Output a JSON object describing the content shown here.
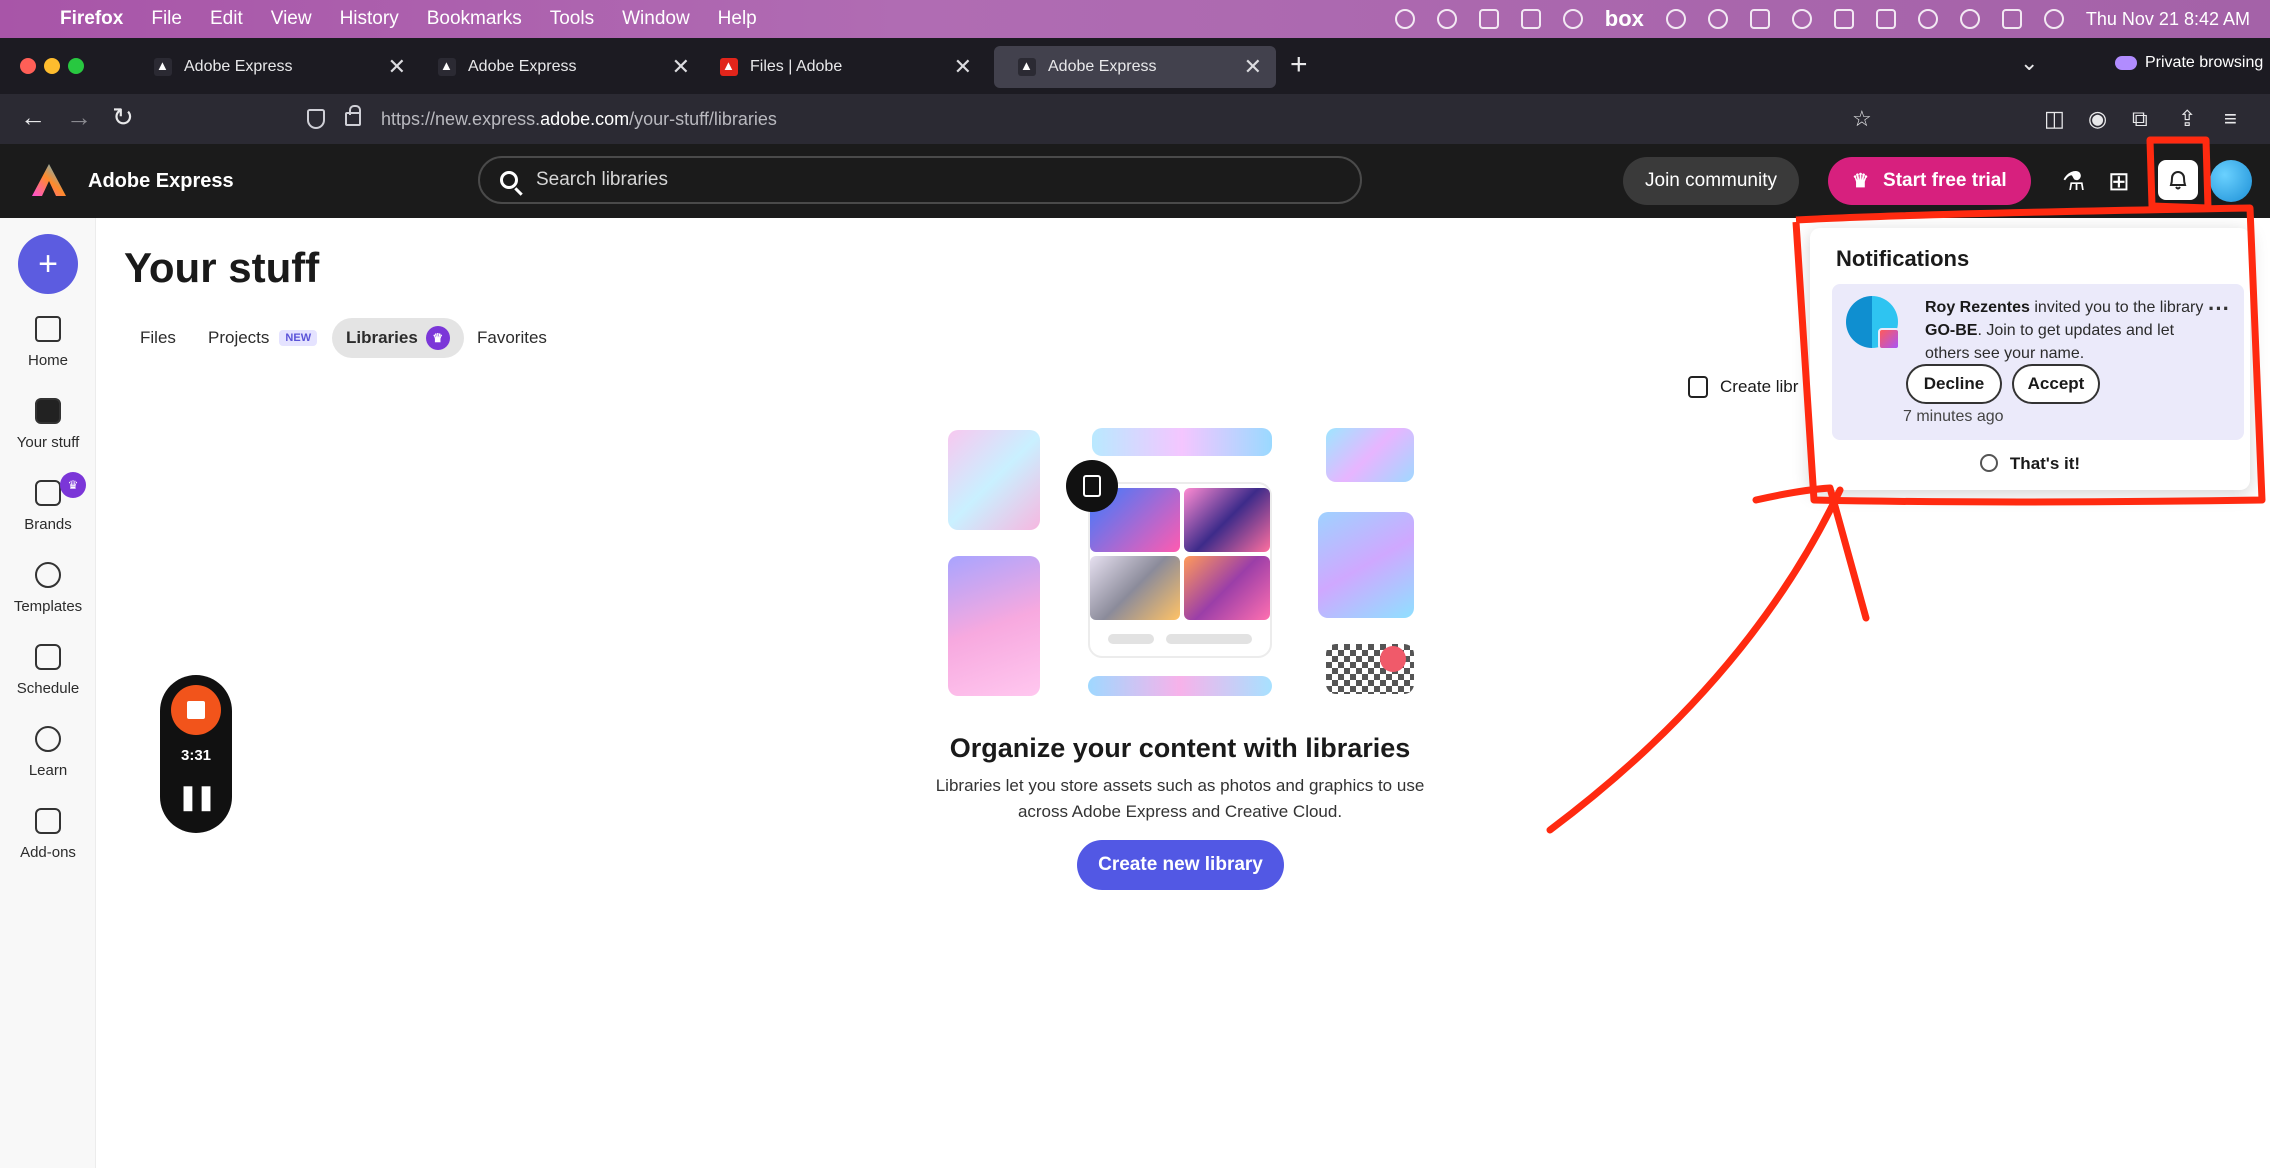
{
  "menubar": {
    "items": [
      "Firefox",
      "File",
      "Edit",
      "View",
      "History",
      "Bookmarks",
      "Tools",
      "Window",
      "Help"
    ],
    "box_label": "box",
    "clock": "Thu Nov 21  8:42 AM"
  },
  "browser": {
    "tabs": [
      {
        "label": "Adobe Express"
      },
      {
        "label": "Adobe Express"
      },
      {
        "label": "Files | Adobe"
      },
      {
        "label": "Adobe Express"
      }
    ],
    "close_glyph": "✕",
    "new_tab": "+",
    "private": "Private browsing",
    "url_prefix": "https://new.express.",
    "url_host": "adobe.com",
    "url_path": "/your-stuff/libraries"
  },
  "header": {
    "app_name": "Adobe Express",
    "search_placeholder": "Search libraries",
    "join": "Join community",
    "trial": "Start free trial"
  },
  "sidebar": {
    "items": [
      {
        "label": "Home",
        "icon": "home-icon"
      },
      {
        "label": "Your stuff",
        "icon": "folder-icon"
      },
      {
        "label": "Brands",
        "icon": "brand-icon"
      },
      {
        "label": "Templates",
        "icon": "templates-icon"
      },
      {
        "label": "Schedule",
        "icon": "calendar-icon"
      },
      {
        "label": "Learn",
        "icon": "lightbulb-icon"
      },
      {
        "label": "Add-ons",
        "icon": "addons-icon"
      }
    ]
  },
  "recorder": {
    "time": "3:31"
  },
  "main": {
    "title": "Your stuff",
    "tabs": [
      {
        "label": "Files"
      },
      {
        "label": "Projects",
        "badge": "NEW"
      },
      {
        "label": "Libraries"
      },
      {
        "label": "Favorites"
      }
    ],
    "create_library_short": "Create libr"
  },
  "empty_state": {
    "title": "Organize your content with libraries",
    "desc_line1": "Libraries let you store assets such as photos and graphics to use",
    "desc_line2": "across Adobe Express and Creative Cloud.",
    "button": "Create new library"
  },
  "notifications": {
    "title": "Notifications",
    "sender": "Roy Rezentes",
    "message_part1": " invited you to the library ",
    "library": "GO-BE",
    "message_part2": ". Join to get updates and let others see your name.",
    "decline": "Decline",
    "accept": "Accept",
    "time": "7 minutes ago",
    "done": "That's it!"
  },
  "colors": {
    "accent": "#5258e4",
    "trial": "#d7207e",
    "annotation": "#ff2a10",
    "premium": "#7b36d8"
  }
}
